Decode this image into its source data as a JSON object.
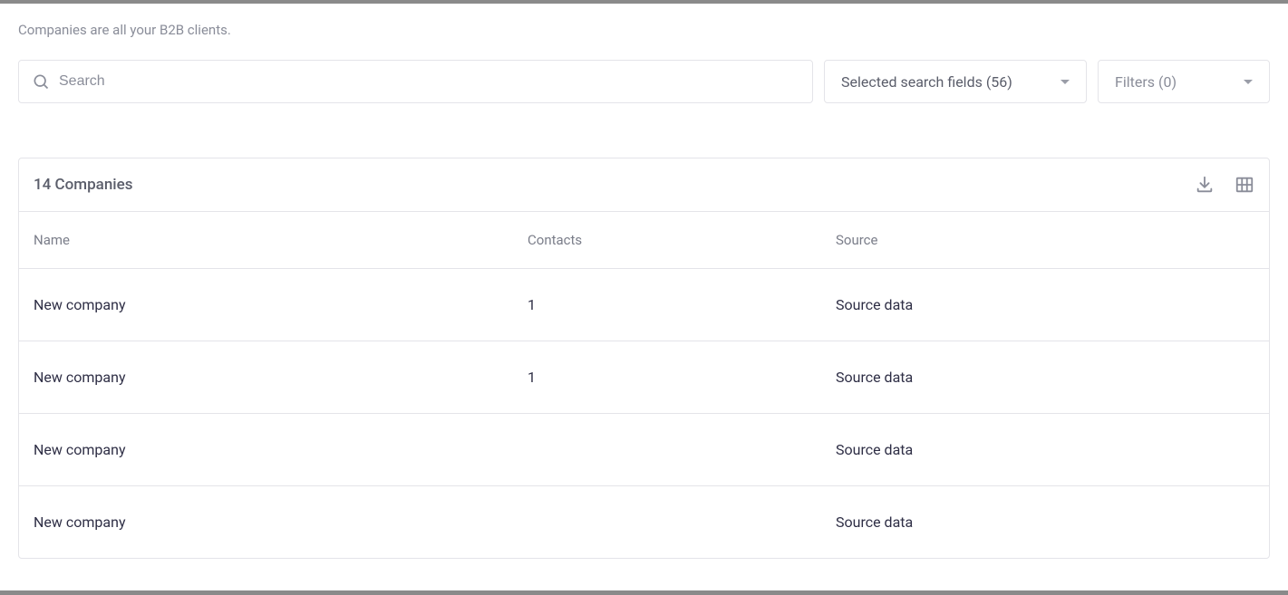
{
  "description": "Companies are all your B2B clients.",
  "search": {
    "placeholder": "Search"
  },
  "search_fields_dropdown": {
    "label": "Selected search fields (56)"
  },
  "filters_dropdown": {
    "label": "Filters (0)"
  },
  "table": {
    "title": "14 Companies",
    "columns": {
      "name": "Name",
      "contacts": "Contacts",
      "source": "Source"
    },
    "rows": [
      {
        "name": "New company",
        "contacts": "1",
        "source": "Source data"
      },
      {
        "name": "New company",
        "contacts": "1",
        "source": "Source data"
      },
      {
        "name": "New company",
        "contacts": "",
        "source": "Source data"
      },
      {
        "name": "New company",
        "contacts": "",
        "source": "Source data"
      }
    ]
  }
}
